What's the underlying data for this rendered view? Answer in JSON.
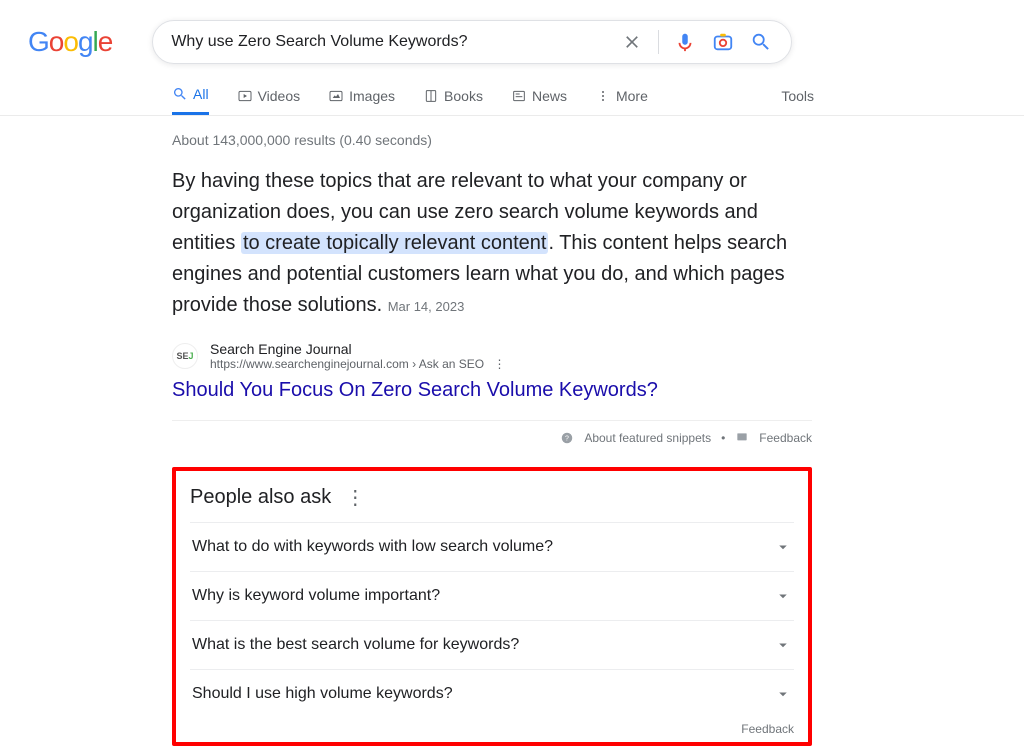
{
  "query": "Why use Zero Search Volume Keywords?",
  "tabs": {
    "all": "All",
    "videos": "Videos",
    "images": "Images",
    "books": "Books",
    "news": "News",
    "more": "More",
    "tools": "Tools"
  },
  "stats": "About 143,000,000 results (0.40 seconds)",
  "snippet": {
    "before": "By having these topics that are relevant to what your company or organization does, you can use zero search volume keywords and entities ",
    "highlight": "to create topically relevant content",
    "after": ". This content helps search engines and potential customers learn what you do, and which pages provide those solutions.",
    "date": "Mar 14, 2023"
  },
  "source": {
    "name": "Search Engine Journal",
    "url": "https://www.searchenginejournal.com › Ask an SEO"
  },
  "result_title": "Should You Focus On Zero Search Volume Keywords?",
  "fs": {
    "about": "About featured snippets",
    "feedback": "Feedback"
  },
  "paa": {
    "title": "People also ask",
    "items": [
      "What to do with keywords with low search volume?",
      "Why is keyword volume important?",
      "What is the best search volume for keywords?",
      "Should I use high volume keywords?"
    ],
    "feedback": "Feedback"
  }
}
